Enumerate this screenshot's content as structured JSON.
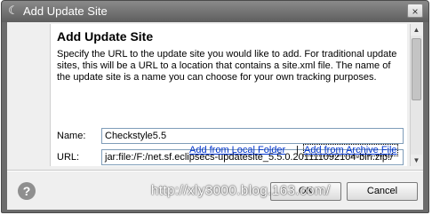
{
  "window": {
    "title": "Add Update Site",
    "app_icon": "eclipse-logo-icon",
    "close_label": "×"
  },
  "banner": {
    "heading": "Add Update Site",
    "description": "Specify the URL to the update site you would like to add.  For traditional update sites, this will be a URL to a location that contains a site.xml file. The name of the update site is a name you can choose for your own tracking purposes."
  },
  "form": {
    "name_label": "Name:",
    "name_value": "Checkstyle5.5",
    "url_label": "URL:",
    "url_value": "jar:file:/F:/net.sf.eclipsecs-updatesite_5.5.0.201111092104-bin.zip!/"
  },
  "links": {
    "local_folder": "Add from Local Folder",
    "separator": "|",
    "archive_file": "Add from Archive File"
  },
  "footer": {
    "help_glyph": "?",
    "ok_label": "OK",
    "cancel_label": "Cancel"
  },
  "watermark": "http://xly3000.blog.163.com/"
}
